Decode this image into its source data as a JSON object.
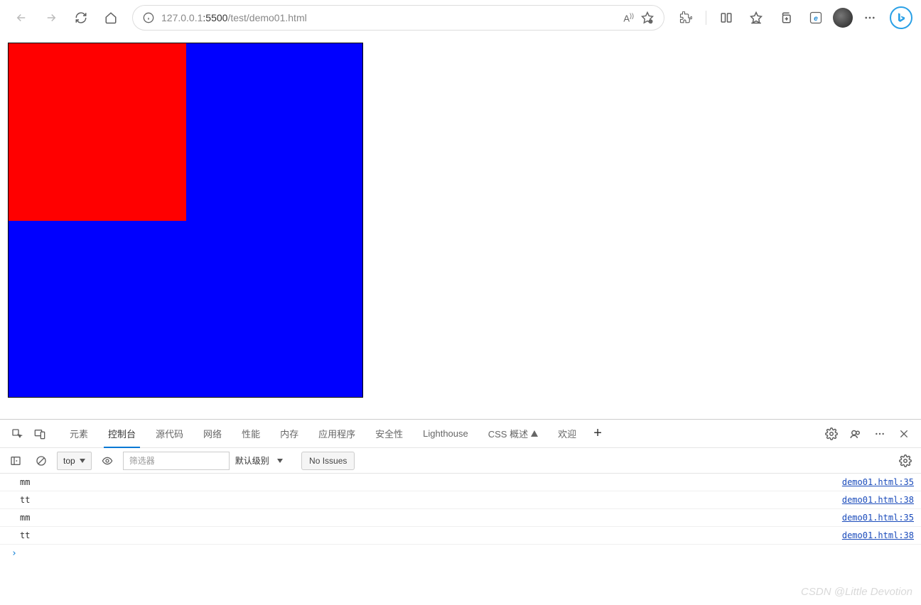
{
  "browser": {
    "url_host": "127.0.0.1",
    "url_port": ":5500",
    "url_path": "/test/demo01.html"
  },
  "page": {
    "outer_color": "#0000ff",
    "inner_color": "#ff0000"
  },
  "devtools": {
    "tabs": {
      "elements": "元素",
      "console": "控制台",
      "sources": "源代码",
      "network": "网络",
      "performance": "性能",
      "memory": "内存",
      "application": "应用程序",
      "security": "安全性",
      "lighthouse": "Lighthouse",
      "css_overview": "CSS 概述",
      "welcome": "欢迎"
    },
    "console_toolbar": {
      "context": "top",
      "filter_placeholder": "筛选器",
      "level": "默认级别",
      "no_issues": "No Issues"
    },
    "console_messages": [
      {
        "text": "mm",
        "source": "demo01.html:35"
      },
      {
        "text": "tt",
        "source": "demo01.html:38"
      },
      {
        "text": "mm",
        "source": "demo01.html:35"
      },
      {
        "text": "tt",
        "source": "demo01.html:38"
      }
    ],
    "prompt": "›"
  },
  "watermark": "CSDN @Little Devotion"
}
